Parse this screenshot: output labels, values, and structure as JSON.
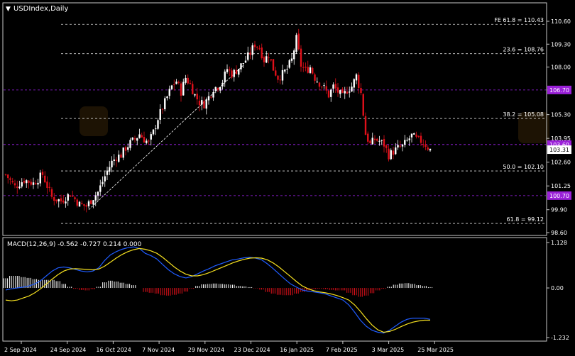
{
  "window": {
    "title": "USDIndex,Daily"
  },
  "colors": {
    "background": "#000000",
    "frame": "#c8c8c8",
    "text": "#ffffff",
    "bull": "#ffffff",
    "bear": "#e0101a",
    "fib_line": "#d8d8d8",
    "level_line": "#a020f0",
    "level_tag": "#9a20d8",
    "price_tag": "#ffffff",
    "macd_line": "#1f5cff",
    "signal_line": "#f5e020",
    "hist_pos": "#ffffff",
    "hist_neg": "#e0101a"
  },
  "chart_data": [
    {
      "type": "candlestick",
      "title": "USDIndex,Daily",
      "x": [
        "2 Sep 2024",
        "24 Sep 2024",
        "16 Oct 2024",
        "7 Nov 2024",
        "29 Nov 2024",
        "23 Dec 2024",
        "16 Jan 2025",
        "7 Feb 2025",
        "3 Mar 2025",
        "25 Mar 2025"
      ],
      "y_ticks": [
        110.6,
        109.3,
        108.0,
        106.7,
        105.3,
        103.95,
        102.6,
        101.25,
        99.9,
        98.6
      ],
      "ylim": [
        98.6,
        110.6
      ],
      "fib_levels": [
        {
          "label": "FE 61.8 = 110.43",
          "value": 110.43
        },
        {
          "label": "23.6 = 108.76",
          "value": 108.76
        },
        {
          "label": "38.2 = 105.08",
          "value": 105.08
        },
        {
          "label": "50.0 = 102.10",
          "value": 102.1
        },
        {
          "label": "61.8 = 99.12",
          "value": 99.12
        }
      ],
      "price_levels": [
        {
          "label": "106.70",
          "value": 106.7
        },
        {
          "label": "103.60",
          "value": 103.6
        },
        {
          "label": "100.70",
          "value": 100.7
        }
      ],
      "current_price": {
        "label": "103.31",
        "value": 103.31
      },
      "swing_line": {
        "from": {
          "x": "26 Sep 2024",
          "value": 99.9
        },
        "to": {
          "x": "8 Nov 2024",
          "value": 108.1
        }
      },
      "path": [
        [
          0,
          101.9
        ],
        [
          4,
          101.2
        ],
        [
          8,
          101.6
        ],
        [
          12,
          101.4
        ],
        [
          16,
          101.9
        ],
        [
          20,
          100.6
        ],
        [
          24,
          100.4
        ],
        [
          28,
          100.8
        ],
        [
          32,
          100.2
        ],
        [
          35,
          100.1
        ],
        [
          38,
          100.6
        ],
        [
          40,
          100.9
        ],
        [
          42,
          101.5
        ],
        [
          44,
          102.1
        ],
        [
          46,
          102.6
        ],
        [
          48,
          102.9
        ],
        [
          50,
          103.0
        ],
        [
          52,
          103.4
        ],
        [
          54,
          103.7
        ],
        [
          56,
          103.9
        ],
        [
          58,
          104.2
        ],
        [
          60,
          103.9
        ],
        [
          62,
          103.7
        ],
        [
          64,
          104.3
        ],
        [
          66,
          105.1
        ],
        [
          68,
          105.7
        ],
        [
          70,
          106.3
        ],
        [
          72,
          106.9
        ],
        [
          74,
          107.2
        ],
        [
          76,
          106.6
        ],
        [
          78,
          107.4
        ],
        [
          80,
          107.0
        ],
        [
          82,
          106.4
        ],
        [
          84,
          106.0
        ],
        [
          86,
          105.9
        ],
        [
          88,
          106.3
        ],
        [
          90,
          106.8
        ],
        [
          92,
          106.9
        ],
        [
          94,
          107.2
        ],
        [
          96,
          107.9
        ],
        [
          98,
          107.6
        ],
        [
          100,
          107.8
        ],
        [
          102,
          108.1
        ],
        [
          104,
          108.4
        ],
        [
          106,
          108.8
        ],
        [
          108,
          109.3
        ],
        [
          110,
          109.1
        ],
        [
          112,
          108.4
        ],
        [
          114,
          108.7
        ],
        [
          116,
          107.9
        ],
        [
          118,
          107.4
        ],
        [
          120,
          107.6
        ],
        [
          122,
          107.9
        ],
        [
          124,
          108.4
        ],
        [
          126,
          109.6
        ],
        [
          128,
          108.1
        ],
        [
          130,
          107.8
        ],
        [
          132,
          108.0
        ],
        [
          134,
          107.4
        ],
        [
          136,
          107.1
        ],
        [
          138,
          106.8
        ],
        [
          140,
          106.4
        ],
        [
          142,
          106.9
        ],
        [
          144,
          106.6
        ],
        [
          146,
          106.3
        ],
        [
          148,
          106.7
        ],
        [
          150,
          106.9
        ],
        [
          152,
          107.5
        ],
        [
          154,
          106.5
        ],
        [
          156,
          104.2
        ],
        [
          158,
          103.6
        ],
        [
          160,
          103.9
        ],
        [
          162,
          103.8
        ],
        [
          164,
          103.6
        ],
        [
          166,
          103.0
        ],
        [
          168,
          103.2
        ],
        [
          170,
          103.4
        ],
        [
          172,
          103.5
        ],
        [
          174,
          103.8
        ],
        [
          176,
          104.1
        ],
        [
          178,
          103.9
        ],
        [
          180,
          103.8
        ],
        [
          182,
          103.6
        ],
        [
          184,
          103.3
        ]
      ]
    },
    {
      "type": "line",
      "title": "MACD(12,26,9) -0.562 -0.727 0.214 0.000",
      "y_ticks": [
        1.128,
        0.0,
        -1.232
      ],
      "ylim": [
        -1.232,
        1.128
      ],
      "series": [
        {
          "name": "MACD",
          "values": [
            -0.05,
            -0.02,
            0.0,
            0.02,
            0.05,
            0.1,
            0.18,
            0.3,
            0.42,
            0.5,
            0.52,
            0.5,
            0.46,
            0.42,
            0.4,
            0.42,
            0.5,
            0.68,
            0.82,
            0.9,
            0.96,
            1.0,
            1.02,
            0.98,
            0.86,
            0.8,
            0.72,
            0.58,
            0.45,
            0.35,
            0.28,
            0.25,
            0.28,
            0.35,
            0.42,
            0.48,
            0.55,
            0.6,
            0.65,
            0.7,
            0.72,
            0.75,
            0.76,
            0.74,
            0.7,
            0.6,
            0.48,
            0.35,
            0.22,
            0.1,
            0.02,
            -0.05,
            -0.08,
            -0.1,
            -0.12,
            -0.15,
            -0.2,
            -0.25,
            -0.3,
            -0.42,
            -0.6,
            -0.8,
            -0.95,
            -1.05,
            -1.1,
            -1.12,
            -1.05,
            -0.95,
            -0.85,
            -0.78,
            -0.75,
            -0.75,
            -0.75,
            -0.78
          ]
        },
        {
          "name": "Signal",
          "values": [
            -0.3,
            -0.32,
            -0.3,
            -0.25,
            -0.2,
            -0.12,
            -0.02,
            0.1,
            0.22,
            0.33,
            0.42,
            0.47,
            0.48,
            0.47,
            0.46,
            0.45,
            0.47,
            0.54,
            0.64,
            0.74,
            0.83,
            0.9,
            0.95,
            0.98,
            0.96,
            0.92,
            0.86,
            0.76,
            0.64,
            0.52,
            0.42,
            0.34,
            0.3,
            0.3,
            0.33,
            0.38,
            0.44,
            0.5,
            0.56,
            0.62,
            0.67,
            0.71,
            0.74,
            0.75,
            0.74,
            0.7,
            0.62,
            0.52,
            0.4,
            0.28,
            0.16,
            0.05,
            -0.02,
            -0.07,
            -0.1,
            -0.12,
            -0.15,
            -0.19,
            -0.24,
            -0.3,
            -0.42,
            -0.58,
            -0.76,
            -0.92,
            -1.04,
            -1.1,
            -1.08,
            -1.03,
            -0.96,
            -0.9,
            -0.85,
            -0.82,
            -0.8,
            -0.8
          ]
        },
        {
          "name": "Histogram",
          "values": [
            0.24,
            0.3,
            0.3,
            0.27,
            0.25,
            0.22,
            0.2,
            0.2,
            0.2,
            0.17,
            0.1,
            0.03,
            -0.02,
            -0.05,
            -0.06,
            -0.03,
            0.03,
            0.14,
            0.18,
            0.16,
            0.13,
            0.1,
            0.07,
            0.0,
            -0.1,
            -0.12,
            -0.14,
            -0.18,
            -0.19,
            -0.17,
            -0.14,
            -0.09,
            -0.02,
            0.05,
            0.09,
            0.1,
            0.11,
            0.1,
            0.09,
            0.08,
            0.05,
            0.04,
            0.02,
            -0.01,
            -0.04,
            -0.1,
            -0.14,
            -0.17,
            -0.18,
            -0.18,
            -0.14,
            -0.1,
            -0.06,
            -0.03,
            -0.02,
            -0.03,
            -0.05,
            -0.06,
            -0.06,
            -0.12,
            -0.18,
            -0.22,
            -0.19,
            -0.13,
            -0.06,
            -0.02,
            0.03,
            0.08,
            0.11,
            0.12,
            0.1,
            0.07,
            0.05,
            0.02
          ]
        }
      ]
    }
  ]
}
